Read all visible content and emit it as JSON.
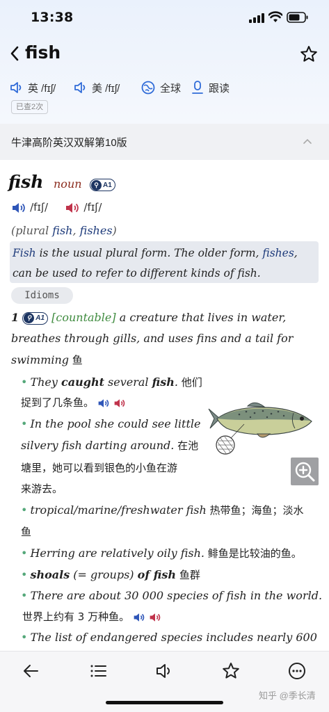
{
  "status": {
    "time": "13:38"
  },
  "header": {
    "title": "fish"
  },
  "pron_row": {
    "uk_label": "英 /fɪʃ/",
    "us_label": "美 /fɪʃ/",
    "global_label": "全球",
    "follow_label": "跟读"
  },
  "seen_badge": "已查2次",
  "dictionary": {
    "name": "牛津高阶英汉双解第10版"
  },
  "entry": {
    "headword": "fish",
    "pos": "noun",
    "level": "A1",
    "ipa_uk": "/fɪʃ/",
    "ipa_us": "/fɪʃ/",
    "plural_open": "(plural ",
    "plural_w1": "fish",
    "plural_sep": ", ",
    "plural_w2": "fishes",
    "plural_close": ")",
    "note_w1": "Fish",
    "note_t1": " is the usual plural form. The older form, ",
    "note_w2": "fishes",
    "note_t2": ",",
    "note_line2": "can be used to refer to different kinds of fish.",
    "idioms_label": "Idioms"
  },
  "sense1": {
    "number": "1",
    "level": "A1",
    "grammar": "[countable]",
    "def_1": " a creature that lives in water,",
    "def_2": "breathes through gills, and uses fins and a tail for",
    "def_3": "swimming",
    "def_cn": " 鱼"
  },
  "examples": {
    "ex1_a": "They ",
    "ex1_b": "caught",
    "ex1_c": " several ",
    "ex1_d": "fish",
    "ex1_e": ".",
    "ex1_cn1": " 他们",
    "ex1_cn2": "捉到了几条鱼。",
    "ex2_1": "In the pool she could see little",
    "ex2_2": "silvery fish darting around.",
    "ex2_cn1": " 在池",
    "ex2_cn2": "塘里，她可以看到银色的小鱼在游",
    "ex2_cn3": "来游去。",
    "ex3": "tropical/marine/freshwater fish",
    "ex3_cn1": " 热带鱼；海鱼；淡水",
    "ex3_cn2": "鱼",
    "ex4": "Herring are relatively oily fish.",
    "ex4_cn": "  鲱鱼是比较油的鱼。",
    "ex5_a": "shoals",
    "ex5_b": " (= groups) ",
    "ex5_c": "of fish",
    "ex5_cn": " 鱼群",
    "ex6": "There are about 30 000 species of fish in the world.",
    "ex6_cn": "世界上约有 3 万种鱼。",
    "ex7": "The list of endangered species includes nearly 600"
  },
  "watermark": "知乎 @季长清",
  "icons": {
    "back": "chevron-left-icon",
    "favorite": "star-icon",
    "speaker": "speaker-icon",
    "global": "globe-icon",
    "mic": "mic-icon",
    "zoom": "zoom-in-icon",
    "list": "list-icon",
    "audio": "audio-icon",
    "more": "more-icon"
  },
  "colors": {
    "uk_speaker": "#2f56b8",
    "us_speaker": "#c0334b",
    "headword_pos": "#8a2a1c",
    "example_dot": "#55a87a",
    "grammar": "#3f8b3f"
  }
}
